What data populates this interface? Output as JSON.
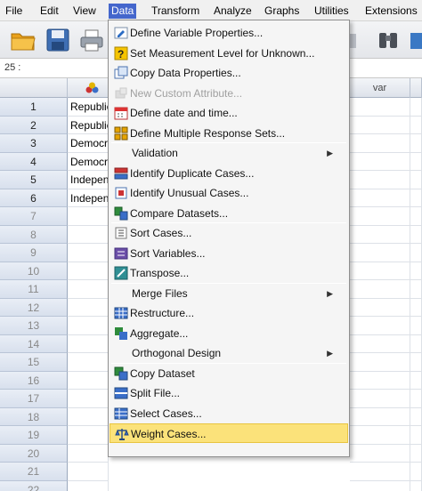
{
  "menubar": {
    "items": [
      "File",
      "Edit",
      "View",
      "Data",
      "Transform",
      "Analyze",
      "Graphs",
      "Utilities",
      "Extensions"
    ],
    "active": "Data"
  },
  "cellbar": {
    "ref": "25 :"
  },
  "grid": {
    "header_var": "var",
    "rows": [
      {
        "num": "1",
        "value": "Republic"
      },
      {
        "num": "2",
        "value": "Republic"
      },
      {
        "num": "3",
        "value": "Democr"
      },
      {
        "num": "4",
        "value": "Democr"
      },
      {
        "num": "5",
        "value": "Indepen"
      },
      {
        "num": "6",
        "value": "Indepen"
      },
      {
        "num": "7",
        "value": ""
      },
      {
        "num": "8",
        "value": ""
      },
      {
        "num": "9",
        "value": ""
      },
      {
        "num": "10",
        "value": ""
      },
      {
        "num": "11",
        "value": ""
      },
      {
        "num": "12",
        "value": ""
      },
      {
        "num": "13",
        "value": ""
      },
      {
        "num": "14",
        "value": ""
      },
      {
        "num": "15",
        "value": ""
      },
      {
        "num": "16",
        "value": ""
      },
      {
        "num": "17",
        "value": ""
      },
      {
        "num": "18",
        "value": ""
      },
      {
        "num": "19",
        "value": ""
      },
      {
        "num": "20",
        "value": ""
      },
      {
        "num": "21",
        "value": ""
      },
      {
        "num": "22",
        "value": ""
      }
    ]
  },
  "data_menu": {
    "items": [
      {
        "label": "Define Variable Properties...",
        "icon": "define-properties-icon"
      },
      {
        "label": "Set Measurement Level for Unknown...",
        "icon": "measurement-level-icon"
      },
      {
        "label": "Copy Data Properties...",
        "icon": "copy-properties-icon"
      },
      {
        "label": "New Custom Attribute...",
        "icon": "custom-attribute-icon",
        "disabled": true
      },
      {
        "label": "Define date and time...",
        "icon": "calendar-icon"
      },
      {
        "label": "Define Multiple Response Sets...",
        "icon": "multiple-response-icon"
      },
      {
        "label": "Validation",
        "submenu": true
      },
      {
        "label": "Identify Duplicate Cases...",
        "icon": "duplicate-cases-icon"
      },
      {
        "label": "Identify Unusual Cases...",
        "icon": "unusual-cases-icon"
      },
      {
        "label": "Compare Datasets...",
        "icon": "compare-datasets-icon"
      },
      {
        "label": "Sort Cases...",
        "icon": "sort-cases-icon"
      },
      {
        "label": "Sort Variables...",
        "icon": "sort-variables-icon"
      },
      {
        "label": "Transpose...",
        "icon": "transpose-icon"
      },
      {
        "label": "Merge Files",
        "submenu": true
      },
      {
        "label": "Restructure...",
        "icon": "restructure-icon"
      },
      {
        "label": "Aggregate...",
        "icon": "aggregate-icon"
      },
      {
        "label": "Orthogonal Design",
        "submenu": true
      },
      {
        "label": "Copy Dataset",
        "icon": "copy-dataset-icon"
      },
      {
        "label": "Split File...",
        "icon": "split-file-icon"
      },
      {
        "label": "Select Cases...",
        "icon": "select-cases-icon"
      },
      {
        "label": "Weight Cases...",
        "icon": "weight-cases-icon",
        "highlighted": true
      }
    ]
  },
  "colors": {
    "menu_active": "#4466cc",
    "highlight": "#fbe27a",
    "rownum_bg": "#dce3ee"
  }
}
